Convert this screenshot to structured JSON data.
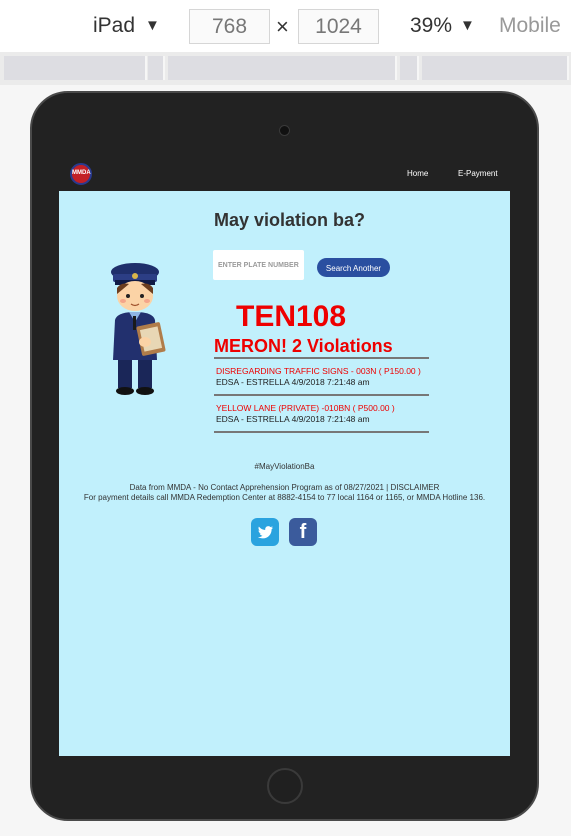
{
  "devtools": {
    "device": "iPad",
    "width": "768",
    "times": "×",
    "height": "1024",
    "zoom": "39%",
    "mode": "Mobile"
  },
  "nav": {
    "logo_text": "MMDA",
    "links": [
      "Home",
      "E-Payment"
    ]
  },
  "main": {
    "heading": "May violation ba?",
    "plate_placeholder": "ENTER PLATE NUMBER",
    "search_button": "Search Another",
    "plate_number": "TEN108",
    "status": "MERON! 2 Violations",
    "violations": [
      {
        "title": "DISREGARDING TRAFFIC SIGNS - 003N ( P150.00 )",
        "location": "EDSA - ESTRELLA 4/9/2018 7:21:48 am"
      },
      {
        "title": "YELLOW LANE (PRIVATE) -010BN ( P500.00 )",
        "location": "EDSA - ESTRELLA 4/9/2018 7:21:48 am"
      }
    ]
  },
  "footer": {
    "hashtag": "#MayViolationBa",
    "line1": "Data from MMDA - No Contact Apprehension Program as of 08/27/2021 | DISCLAIMER",
    "line2": "For payment details call MMDA Redemption Center at 8882-4154 to 77 local 1164 or 1165, or MMDA Hotline 136.",
    "facebook_glyph": "f"
  },
  "colors": {
    "screen_bg": "#c1f0fc",
    "navbar": "#222222",
    "accent_red": "#ee0000",
    "button_blue": "#2a4fa0"
  },
  "icons": [
    "officer-illustration",
    "twitter-icon",
    "facebook-icon",
    "mmda-logo"
  ]
}
